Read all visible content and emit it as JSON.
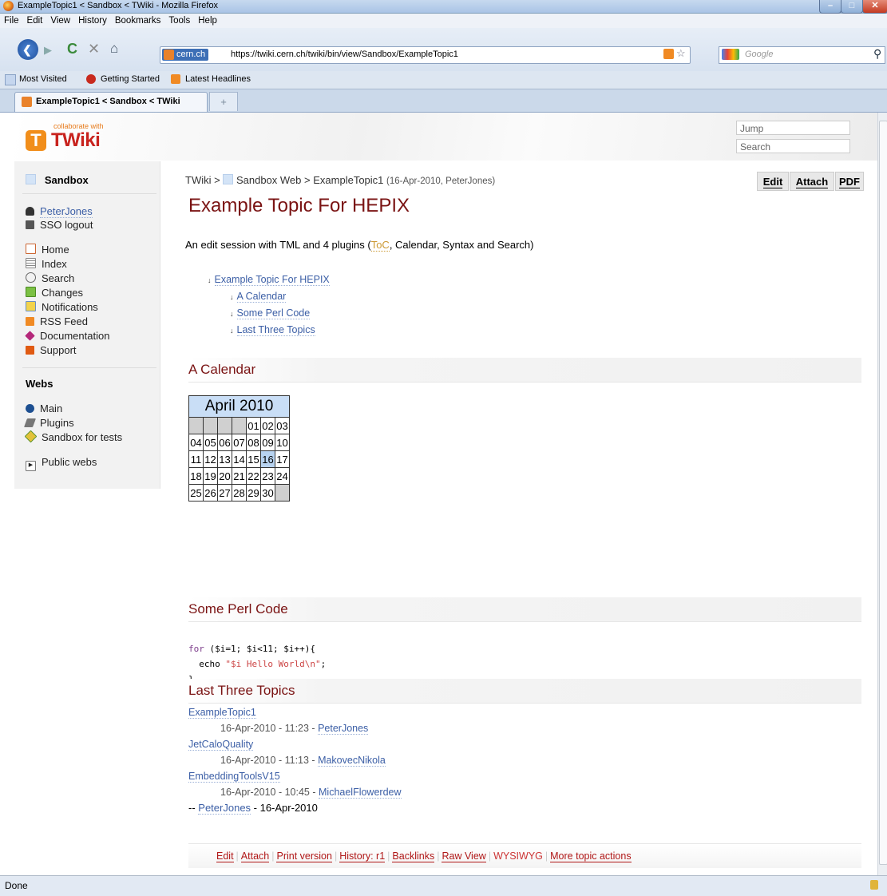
{
  "window": {
    "title": "ExampleTopic1 < Sandbox < TWiki - Mozilla Firefox"
  },
  "menu": [
    "File",
    "Edit",
    "View",
    "History",
    "Bookmarks",
    "Tools",
    "Help"
  ],
  "nav": {
    "site_badge": "cern.ch",
    "url": "https://twiki.cern.ch/twiki/bin/view/Sandbox/ExampleTopic1",
    "search_placeholder": "Google"
  },
  "bookmarks": [
    "Most Visited",
    "Getting Started",
    "Latest Headlines"
  ],
  "tab": {
    "label": "ExampleTopic1 < Sandbox < TWiki",
    "new_tab": "+"
  },
  "header": {
    "logo_tag": "collaborate with",
    "logo_text": "TWiki",
    "jump_placeholder": "Jump",
    "search_placeholder": "Search"
  },
  "sidebar": {
    "web_title": "Sandbox",
    "user": "PeterJones",
    "logout": "SSO logout",
    "items": [
      "Home",
      "Index",
      "Search",
      "Changes",
      "Notifications",
      "RSS Feed",
      "Documentation",
      "Support"
    ],
    "webs_title": "Webs",
    "webs": [
      "Main",
      "Plugins",
      "Sandbox for tests"
    ],
    "public_webs": "Public webs"
  },
  "breadcrumb": {
    "root": "TWiki",
    "sep": ">",
    "web": "Sandbox Web",
    "topic": "ExampleTopic1",
    "meta": "(16-Apr-2010, PeterJones)"
  },
  "actions": {
    "edit": "Edit",
    "attach": "Attach",
    "pdf": "PDF"
  },
  "page": {
    "title": "Example Topic For HEPIX",
    "intro_prefix": "An edit session with TML and 4 plugins (",
    "intro_toc": "ToC",
    "intro_suffix": ", Calendar, Syntax and Search)",
    "toc": [
      "Example Topic For HEPIX",
      "A Calendar",
      "Some Perl Code",
      "Last Three Topics"
    ],
    "sec_calendar": "A Calendar",
    "sec_perl": "Some Perl Code",
    "sec_topics": "Last Three Topics"
  },
  "calendar": {
    "month": "April 2010",
    "today": "16",
    "weeks": [
      [
        "",
        "",
        "",
        "",
        "01",
        "02",
        "03"
      ],
      [
        "04",
        "05",
        "06",
        "07",
        "08",
        "09",
        "10"
      ],
      [
        "11",
        "12",
        "13",
        "14",
        "15",
        "16",
        "17"
      ],
      [
        "18",
        "19",
        "20",
        "21",
        "22",
        "23",
        "24"
      ],
      [
        "25",
        "26",
        "27",
        "28",
        "29",
        "30",
        ""
      ]
    ]
  },
  "perl": {
    "kw": "for",
    "head": " ($i=1; $i<11; $i++){",
    "echo": "  echo ",
    "str": "\"$i Hello World\\n\"",
    "semi": ";",
    "close": "}"
  },
  "topics": [
    {
      "name": "ExampleTopic1",
      "date": "16-Apr-2010 - 11:23 - ",
      "author": "PeterJones"
    },
    {
      "name": "JetCaloQuality",
      "date": "16-Apr-2010 - 11:13 - ",
      "author": "MakovecNikola"
    },
    {
      "name": "EmbeddingToolsV15",
      "date": "16-Apr-2010 - 10:45 - ",
      "author": "MichaelFlowerdew"
    }
  ],
  "signature": {
    "dash": "-- ",
    "author": "PeterJones",
    "date": " - 16-Apr-2010"
  },
  "bottom_actions": [
    "Edit",
    "Attach",
    "Print version",
    "History: r1",
    "Backlinks",
    "Raw View",
    "WYSIWYG",
    "More topic actions"
  ],
  "status": "Done"
}
